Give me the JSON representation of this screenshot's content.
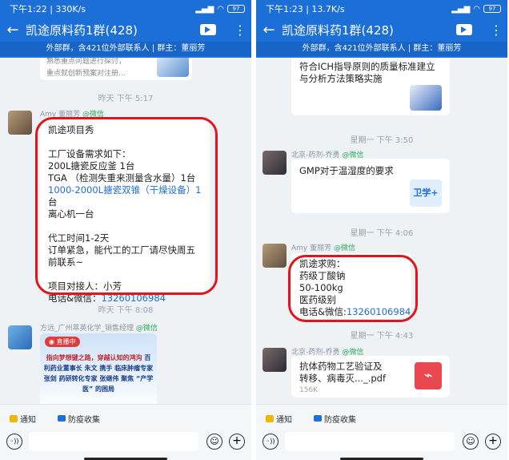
{
  "left": {
    "status": {
      "time": "下午1:22",
      "speed": "330K/s",
      "battery": "97"
    },
    "title": "凯途原料药1群(428)",
    "subtitle": "外部群，含421位外部联系人 | 群主：董丽芳",
    "top_fragment": [
      "熟悉重点问题进行探讨，",
      "重点就创新预案对注册..."
    ],
    "time1": "昨天 下午 5:17",
    "msg1": {
      "sender": "Amy 董丽芳",
      "sender_tag": "@微信",
      "lines": [
        "凯途项目秀",
        "",
        "工厂设备需求如下：",
        "200L搪瓷反应釜 1台",
        "TGA （检测失重来测量含水量）1台",
        "1000-2000L搪瓷双锥（干燥设备）1",
        "台",
        "离心机一台",
        "",
        "代工时间1-2天",
        "订单紧急，能代工的工厂请尽快周五",
        "前联系~",
        "",
        "项目对接人：小芳"
      ],
      "contact_label": "电话&微信：",
      "contact_phone": "13260106984"
    },
    "time2": "昨天 下午 8:08",
    "msg2": {
      "sender": "方远_广州萃英化学_销售经理",
      "sender_tag": "@微信",
      "live_badge": "直播中",
      "poster_lines": [
        "指向梦想键之路，穿越认知的鸿沟",
        "百利药业董事长 朱文",
        "携手 临床肿瘤专家 张剑",
        "药研转化专家 张继伟",
        "聚焦 “产学医” 的困局"
      ]
    },
    "bottom": {
      "notice_label": "通知",
      "epidemic_label": "防疫收集"
    }
  },
  "right": {
    "status": {
      "time": "下午1:23",
      "speed": "13.7K/s",
      "battery": "97"
    },
    "title": "凯途原料药1群(428)",
    "subtitle": "外部群，含421位外部联系人 | 群主：董丽芳",
    "msg0": {
      "lines": [
        "符合ICH指导原则的质量标准建立",
        "与分析方法策略实施"
      ]
    },
    "time1": "星期一 下午 3:50",
    "msg1": {
      "sender": "北京-药剂-乔勇",
      "sender_tag": "@微信",
      "text": "GMP对于温湿度的要求",
      "thumb_label": "卫学+"
    },
    "time2": "星期一 下午 4:06",
    "msg2": {
      "sender": "Amy 董丽芳",
      "sender_tag": "@微信",
      "lines": [
        "凯途求购：",
        "药级丁酸钠",
        "50-100kg",
        "医药级别"
      ],
      "contact_label": "电话&微信:",
      "contact_phone": "13260106984"
    },
    "time3": "星期一 下午 4:43",
    "msg3": {
      "sender": "北京-药剂-乔勇",
      "sender_tag": "@微信",
      "file_line1": "抗体药物工艺验证及",
      "file_line2": "转移、病毒灭..._.pdf",
      "file_size": "156K"
    },
    "bottom": {
      "notice_label": "通知",
      "epidemic_label": "防疫收集"
    }
  },
  "colors": {
    "header": "#1b6fd6",
    "highlight": "#e3141c",
    "link": "#1f6fd3",
    "wechat_tag": "#2dab5f"
  }
}
